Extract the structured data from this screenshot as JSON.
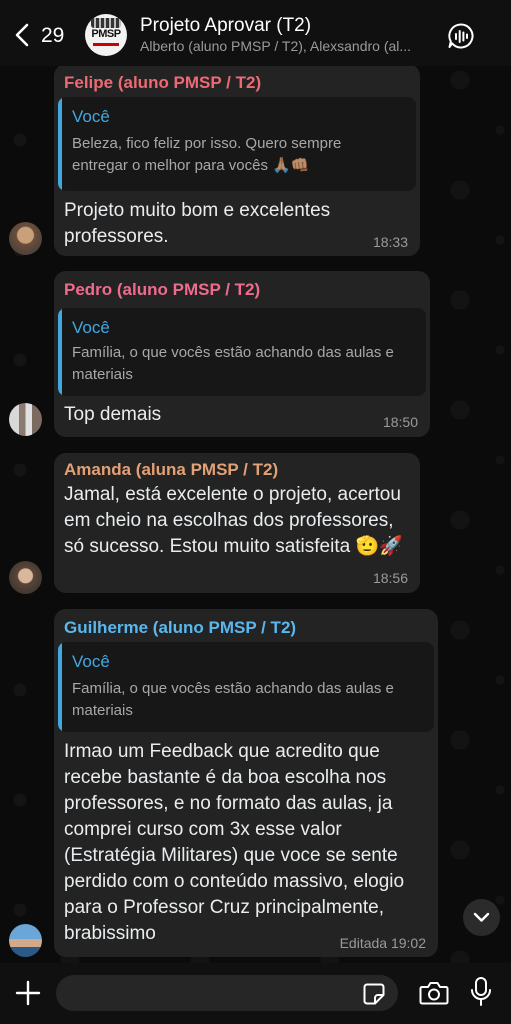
{
  "header": {
    "back_count": "29",
    "title": "Projeto Aprovar (T2)",
    "subtitle": "Alberto (aluno PMSP / T2), Alexsandro (al...",
    "avatar_logo_text": "PMSP"
  },
  "messages": [
    {
      "sender": "Felipe (aluno PMSP / T2)",
      "sender_color": "#ec6a73",
      "quote": {
        "name": "Você",
        "text": "Beleza, fico feliz por isso. Quero sempre entregar o melhor para vocês 🙏🏽👊🏽"
      },
      "text": "Projeto muito bom e excelentes professores.",
      "time": "18:33"
    },
    {
      "sender": "Pedro (aluno PMSP / T2)",
      "sender_color": "#ef6b8d",
      "quote": {
        "name": "Você",
        "text": "Família, o que vocês estão achando das aulas e materiais"
      },
      "text": "Top demais",
      "time": "18:50"
    },
    {
      "sender": "Amanda (aluna PMSP / T2)",
      "sender_color": "#e3a074",
      "text": "Jamal, está  excelente o projeto, acertou em cheio na escolhas dos professores, só sucesso. Estou muito satisfeita 🫡🚀",
      "time": "18:56"
    },
    {
      "sender": "Guilherme (aluno PMSP / T2)",
      "sender_color": "#58b8ee",
      "quote": {
        "name": "Você",
        "text": "Família, o que vocês estão achando das aulas e materiais"
      },
      "text": "Irmao um Feedback que acredito que recebe bastante é da boa escolha nos professores, e no formato das aulas, ja comprei curso com 3x esse valor (Estratégia Militares) que voce se sente perdido com o conteúdo massivo, elogio para o Professor Cruz principalmente, brabissimo",
      "time": "Editada 19:02"
    }
  ],
  "composer": {
    "placeholder": ""
  },
  "colors": {
    "quote_accent": "#41a8e0",
    "bubble": "#232323",
    "background": "#0b0b0b"
  },
  "icons": [
    "back-chevron-icon",
    "voice-chat-icon",
    "chevron-down-icon",
    "plus-icon",
    "sticker-icon",
    "camera-icon",
    "microphone-icon"
  ]
}
